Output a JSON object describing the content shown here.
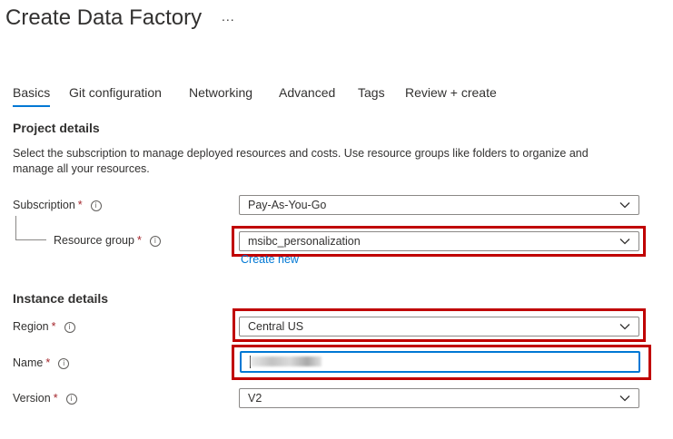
{
  "header": {
    "title": "Create Data Factory",
    "more_label": "..."
  },
  "tabs": [
    {
      "label": "Basics",
      "active": true
    },
    {
      "label": "Git configuration",
      "active": false
    },
    {
      "label": "Networking",
      "active": false
    },
    {
      "label": "Advanced",
      "active": false
    },
    {
      "label": "Tags",
      "active": false
    },
    {
      "label": "Review + create",
      "active": false
    }
  ],
  "project_details": {
    "heading": "Project details",
    "description": "Select the subscription to manage deployed resources and costs. Use resource groups like folders to organize and manage all your resources.",
    "subscription": {
      "label": "Subscription",
      "required_mark": "*",
      "value": "Pay-As-You-Go"
    },
    "resource_group": {
      "label": "Resource group",
      "required_mark": "*",
      "value": "msibc_personalization",
      "create_new_label": "Create new"
    }
  },
  "instance_details": {
    "heading": "Instance details",
    "region": {
      "label": "Region",
      "required_mark": "*",
      "value": "Central US"
    },
    "name": {
      "label": "Name",
      "required_mark": "*",
      "value_obscured": true
    },
    "version": {
      "label": "Version",
      "required_mark": "*",
      "value": "V2"
    }
  },
  "info_glyph": "i",
  "colors": {
    "accent": "#0078d4",
    "highlight": "#c00000",
    "required": "#a4262c",
    "text": "#323130"
  }
}
